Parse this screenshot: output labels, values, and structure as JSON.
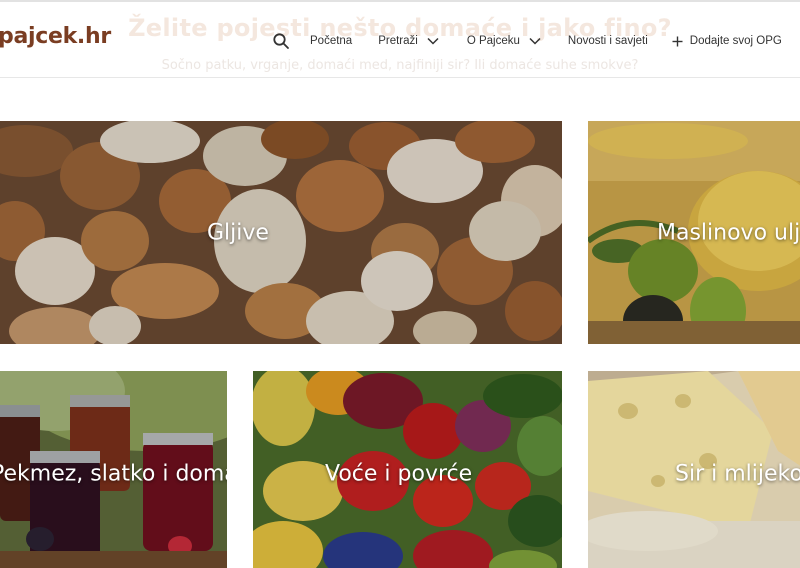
{
  "hero": {
    "title": "Želite pojesti nešto domaće i jako fino?",
    "subtitle": "Sočno patku, vrganje, domaći med, najfiniji sir? Ili domaće suhe smokve?"
  },
  "header": {
    "logo": "pajcek.hr",
    "nav": {
      "home": "Početna",
      "search": "Pretraži",
      "about": "O Pajceku",
      "news": "Novosti i savjeti",
      "add": "Dodajte svoj OPG"
    }
  },
  "categories": [
    {
      "label": "Gljive"
    },
    {
      "label": "Maslinovo ulje"
    },
    {
      "label": "Pekmez, slatko i domaće"
    },
    {
      "label": "Voće i povrće"
    },
    {
      "label": "Sir i mlijeko"
    }
  ],
  "colors": {
    "brand": "#7a3d22",
    "nav_text": "#333333",
    "header_border": "#e2e2e2"
  },
  "icons": {
    "search": "search-icon",
    "dropdown": "chevron-down-icon",
    "add": "plus-icon"
  }
}
